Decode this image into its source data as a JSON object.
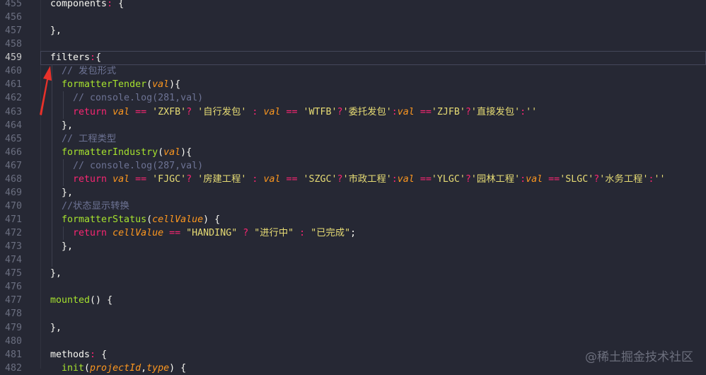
{
  "editor": {
    "current_line": 459,
    "lines": [
      {
        "num": "455",
        "indent": 0,
        "tokens": [
          [
            "plain",
            "components"
          ],
          [
            "punc",
            ":"
          ],
          [
            "plain",
            " {"
          ]
        ]
      },
      {
        "num": "456",
        "indent": 0,
        "tokens": []
      },
      {
        "num": "457",
        "indent": 0,
        "tokens": [
          [
            "plain",
            "},"
          ]
        ]
      },
      {
        "num": "458",
        "indent": 0,
        "tokens": []
      },
      {
        "num": "459",
        "indent": 0,
        "tokens": [
          [
            "plain",
            "filters"
          ],
          [
            "punc",
            ":"
          ],
          [
            "plain",
            "{"
          ]
        ]
      },
      {
        "num": "460",
        "indent": 1,
        "tokens": [
          [
            "comment",
            "// 发包形式"
          ]
        ]
      },
      {
        "num": "461",
        "indent": 1,
        "tokens": [
          [
            "fn",
            "formatterTender"
          ],
          [
            "plain",
            "("
          ],
          [
            "param",
            "val"
          ],
          [
            "plain",
            "){"
          ]
        ]
      },
      {
        "num": "462",
        "indent": 2,
        "tokens": [
          [
            "comment",
            "// console.log(281,val)"
          ]
        ]
      },
      {
        "num": "463",
        "indent": 2,
        "tokens": [
          [
            "kw",
            "return"
          ],
          [
            "plain",
            " "
          ],
          [
            "param",
            "val"
          ],
          [
            "op",
            " == "
          ],
          [
            "str",
            "'ZXFB'"
          ],
          [
            "op",
            "?"
          ],
          [
            "plain",
            " "
          ],
          [
            "str",
            "'自行发包'"
          ],
          [
            "op",
            " : "
          ],
          [
            "param",
            "val"
          ],
          [
            "op",
            " == "
          ],
          [
            "str",
            "'WTFB'"
          ],
          [
            "op",
            "?"
          ],
          [
            "str",
            "'委托发包'"
          ],
          [
            "op",
            ":"
          ],
          [
            "param",
            "val"
          ],
          [
            "op",
            " =="
          ],
          [
            "str",
            "'ZJFB'"
          ],
          [
            "op",
            "?"
          ],
          [
            "str",
            "'直接发包'"
          ],
          [
            "op",
            ":"
          ],
          [
            "str",
            "''"
          ]
        ]
      },
      {
        "num": "464",
        "indent": 1,
        "tokens": [
          [
            "plain",
            "},"
          ]
        ]
      },
      {
        "num": "465",
        "indent": 1,
        "tokens": [
          [
            "comment",
            "// 工程类型"
          ]
        ]
      },
      {
        "num": "466",
        "indent": 1,
        "tokens": [
          [
            "fn",
            "formatterIndustry"
          ],
          [
            "plain",
            "("
          ],
          [
            "param",
            "val"
          ],
          [
            "plain",
            "){"
          ]
        ]
      },
      {
        "num": "467",
        "indent": 2,
        "tokens": [
          [
            "comment",
            "// console.log(287,val)"
          ]
        ]
      },
      {
        "num": "468",
        "indent": 2,
        "tokens": [
          [
            "kw",
            "return"
          ],
          [
            "plain",
            " "
          ],
          [
            "param",
            "val"
          ],
          [
            "op",
            " == "
          ],
          [
            "str",
            "'FJGC'"
          ],
          [
            "op",
            "?"
          ],
          [
            "plain",
            " "
          ],
          [
            "str",
            "'房建工程'"
          ],
          [
            "op",
            " : "
          ],
          [
            "param",
            "val"
          ],
          [
            "op",
            " == "
          ],
          [
            "str",
            "'SZGC'"
          ],
          [
            "op",
            "?"
          ],
          [
            "str",
            "'市政工程'"
          ],
          [
            "op",
            ":"
          ],
          [
            "param",
            "val"
          ],
          [
            "op",
            " =="
          ],
          [
            "str",
            "'YLGC'"
          ],
          [
            "op",
            "?"
          ],
          [
            "str",
            "'园林工程'"
          ],
          [
            "op",
            ":"
          ],
          [
            "param",
            "val"
          ],
          [
            "op",
            " =="
          ],
          [
            "str",
            "'SLGC'"
          ],
          [
            "op",
            "?"
          ],
          [
            "str",
            "'水务工程'"
          ],
          [
            "op",
            ":"
          ],
          [
            "str",
            "''"
          ]
        ]
      },
      {
        "num": "469",
        "indent": 1,
        "tokens": [
          [
            "plain",
            "},"
          ]
        ]
      },
      {
        "num": "470",
        "indent": 1,
        "tokens": [
          [
            "comment",
            "//状态显示转换"
          ]
        ]
      },
      {
        "num": "471",
        "indent": 1,
        "tokens": [
          [
            "fn",
            "formatterStatus"
          ],
          [
            "plain",
            "("
          ],
          [
            "param",
            "cellValue"
          ],
          [
            "plain",
            ") {"
          ]
        ]
      },
      {
        "num": "472",
        "indent": 2,
        "tokens": [
          [
            "kw",
            "return"
          ],
          [
            "plain",
            " "
          ],
          [
            "param",
            "cellValue"
          ],
          [
            "op",
            " == "
          ],
          [
            "str",
            "\"HANDING\""
          ],
          [
            "op",
            " ? "
          ],
          [
            "str",
            "\"进行中\""
          ],
          [
            "op",
            " : "
          ],
          [
            "str",
            "\"已完成\""
          ],
          [
            "plain",
            ";"
          ]
        ]
      },
      {
        "num": "473",
        "indent": 1,
        "tokens": [
          [
            "plain",
            "},"
          ]
        ]
      },
      {
        "num": "474",
        "indent": 0,
        "tokens": []
      },
      {
        "num": "475",
        "indent": 0,
        "tokens": [
          [
            "plain",
            "},"
          ]
        ]
      },
      {
        "num": "476",
        "indent": 0,
        "tokens": []
      },
      {
        "num": "477",
        "indent": 0,
        "tokens": [
          [
            "fn",
            "mounted"
          ],
          [
            "plain",
            "() {"
          ]
        ]
      },
      {
        "num": "478",
        "indent": 0,
        "tokens": []
      },
      {
        "num": "479",
        "indent": 0,
        "tokens": [
          [
            "plain",
            "},"
          ]
        ]
      },
      {
        "num": "480",
        "indent": 0,
        "tokens": []
      },
      {
        "num": "481",
        "indent": 0,
        "tokens": [
          [
            "plain",
            "methods"
          ],
          [
            "punc",
            ":"
          ],
          [
            "plain",
            " {"
          ]
        ]
      },
      {
        "num": "482",
        "indent": 1,
        "tokens": [
          [
            "fn",
            "init"
          ],
          [
            "plain",
            "("
          ],
          [
            "param",
            "projectId"
          ],
          [
            "plain",
            ","
          ],
          [
            "param",
            "type"
          ],
          [
            "plain",
            ") {"
          ]
        ]
      }
    ]
  },
  "watermark": "@稀土掘金技术社区",
  "colors": {
    "background": "#262834",
    "arrow": "#e8312a"
  }
}
